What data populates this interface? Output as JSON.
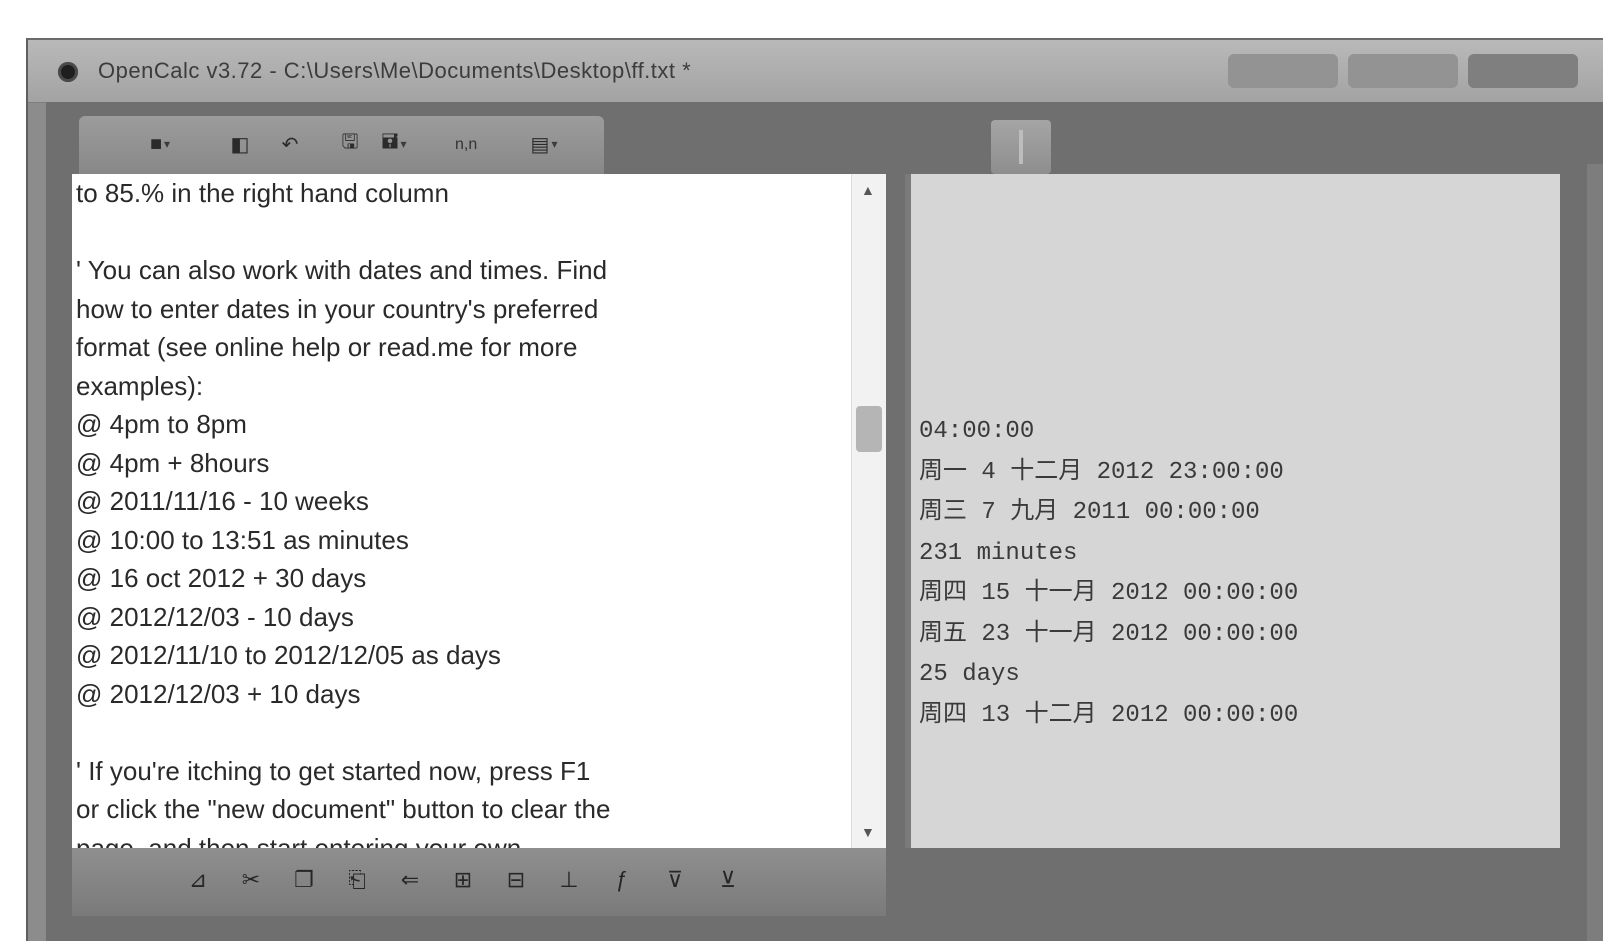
{
  "window": {
    "title": "OpenCalc v3.72 - C:\\Users\\Me\\Documents\\Desktop\\ff.txt *"
  },
  "toolbar": {
    "buttons": [
      {
        "name": "new-document-button",
        "icon": "■",
        "dropdown": "▾"
      },
      {
        "name": "open-button",
        "icon": "◧",
        "dropdown": ""
      },
      {
        "name": "undo-button",
        "icon": "↶",
        "dropdown": ""
      },
      {
        "name": "save-button",
        "icon": "🖫",
        "dropdown": ""
      },
      {
        "name": "save-as-button",
        "icon": "🖬",
        "dropdown": "▾"
      },
      {
        "name": "options-button",
        "icon": "▤",
        "dropdown": "▾"
      }
    ],
    "format_label": "n,n"
  },
  "editor": {
    "lines": [
      "to 85.% in the right hand column",
      "",
      "' You can also work with dates and times. Find",
      "how to enter dates in your country's preferred",
      "format (see online help or read.me for more",
      "examples):",
      "@ 4pm to 8pm",
      "@ 4pm + 8hours",
      "@ 2011/11/16 - 10 weeks",
      "@ 10:00 to 13:51 as minutes",
      "@ 16 oct 2012 + 30 days",
      "@ 2012/12/03 - 10 days",
      "@ 2012/11/10 to 2012/12/05 as days",
      "@ 2012/12/03 + 10 days",
      "",
      "' If you're itching to get started now, press F1",
      "or click the \"new document\" button to clear the",
      "page, and then start entering your own..."
    ]
  },
  "results": {
    "lines": [
      "04:00:00",
      "周一 4 十二月 2012 23:00:00",
      "周三 7 九月 2011 00:00:00",
      "231 minutes",
      "周四 15 十一月 2012 00:00:00",
      "周五 23 十一月 2012 00:00:00",
      "25 days",
      "周四 13 十二月 2012 00:00:00"
    ]
  },
  "bottom_toolbar": {
    "buttons": [
      {
        "name": "bold-button",
        "icon": "⊿"
      },
      {
        "name": "cut-button",
        "icon": "✂"
      },
      {
        "name": "copy-button",
        "icon": "❐"
      },
      {
        "name": "paste-button",
        "icon": "⎗"
      },
      {
        "name": "back-button",
        "icon": "⇐"
      },
      {
        "name": "table-button",
        "icon": "⊞"
      },
      {
        "name": "grid-button",
        "icon": "⊟"
      },
      {
        "name": "chart-button",
        "icon": "⊥"
      },
      {
        "name": "function-button",
        "icon": "ƒ"
      },
      {
        "name": "filter-button",
        "icon": "⊽"
      },
      {
        "name": "help-button",
        "icon": "⊻"
      }
    ]
  },
  "colors": {
    "window_frame": "#8c8c8c",
    "editor_bg": "#ffffff",
    "results_bg": "#d6d6d6"
  }
}
